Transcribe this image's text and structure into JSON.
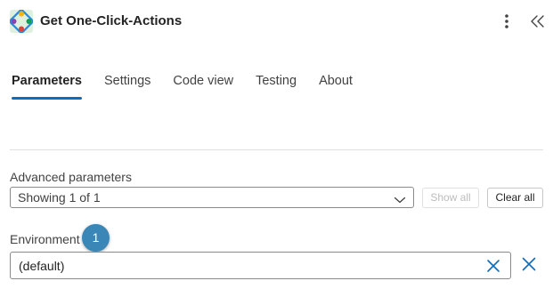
{
  "header": {
    "title": "Get One-Click-Actions",
    "icons": {
      "app": "power-automate-logo",
      "more": "more-vertical-icon",
      "collapse": "double-chevron-left-icon"
    }
  },
  "tabs": [
    {
      "label": "Parameters",
      "active": true
    },
    {
      "label": "Settings",
      "active": false
    },
    {
      "label": "Code view",
      "active": false
    },
    {
      "label": "Testing",
      "active": false
    },
    {
      "label": "About",
      "active": false
    }
  ],
  "advanced": {
    "label": "Advanced parameters",
    "select_value": "Showing 1 of 1",
    "show_all_label": "Show all",
    "clear_all_label": "Clear all"
  },
  "environment": {
    "label": "Environment",
    "value": "(default)",
    "badge": "1"
  },
  "colors": {
    "accent": "#0f6cbd",
    "badge": "#3a86b6",
    "clear_icon": "#0f6cbd"
  }
}
